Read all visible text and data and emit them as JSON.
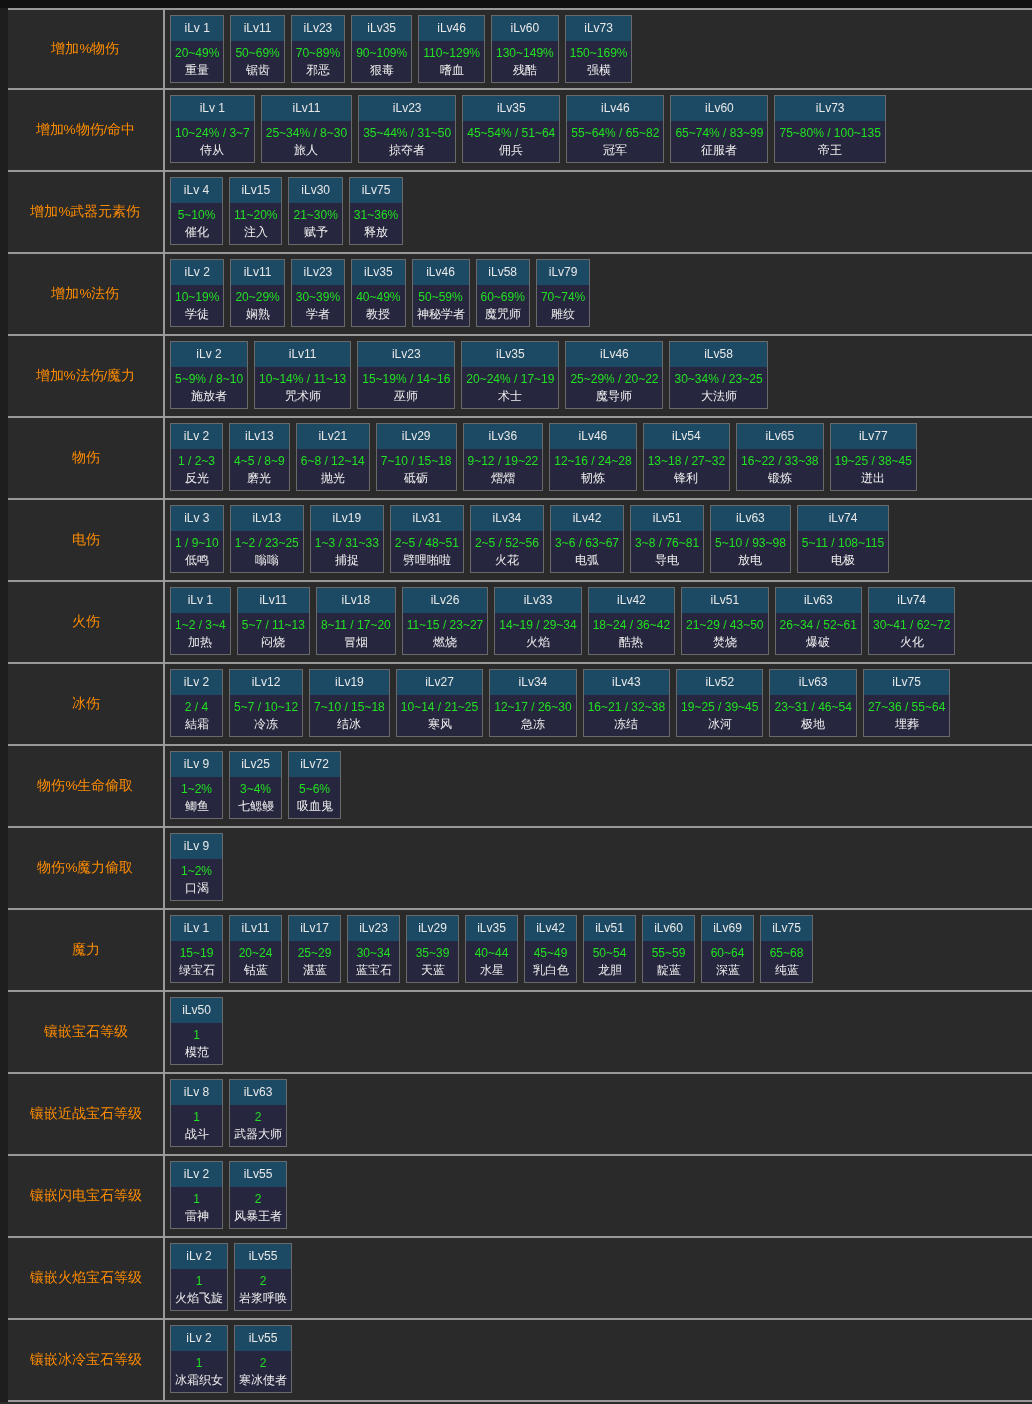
{
  "rows": [
    {
      "label": "增加%物伤",
      "items": [
        {
          "level": "iLv 1",
          "value": "20~49%",
          "name": "重量"
        },
        {
          "level": "iLv11",
          "value": "50~69%",
          "name": "锯齿"
        },
        {
          "level": "iLv23",
          "value": "70~89%",
          "name": "邪恶"
        },
        {
          "level": "iLv35",
          "value": "90~109%",
          "name": "狠毒"
        },
        {
          "level": "iLv46",
          "value": "110~129%",
          "name": "嗜血"
        },
        {
          "level": "iLv60",
          "value": "130~149%",
          "name": "残酷"
        },
        {
          "level": "iLv73",
          "value": "150~169%",
          "name": "强横"
        }
      ]
    },
    {
      "label": "增加%物伤/命中",
      "items": [
        {
          "level": "iLv 1",
          "value": "10~24% / 3~7",
          "name": "侍从"
        },
        {
          "level": "iLv11",
          "value": "25~34% / 8~30",
          "name": "旅人"
        },
        {
          "level": "iLv23",
          "value": "35~44% / 31~50",
          "name": "掠夺者"
        },
        {
          "level": "iLv35",
          "value": "45~54% / 51~64",
          "name": "佣兵"
        },
        {
          "level": "iLv46",
          "value": "55~64% / 65~82",
          "name": "冠军"
        },
        {
          "level": "iLv60",
          "value": "65~74% / 83~99",
          "name": "征服者"
        },
        {
          "level": "iLv73",
          "value": "75~80% / 100~135",
          "name": "帝王"
        }
      ]
    },
    {
      "label": "增加%武器元素伤",
      "items": [
        {
          "level": "iLv 4",
          "value": "5~10%",
          "name": "催化"
        },
        {
          "level": "iLv15",
          "value": "11~20%",
          "name": "注入"
        },
        {
          "level": "iLv30",
          "value": "21~30%",
          "name": "赋予"
        },
        {
          "level": "iLv75",
          "value": "31~36%",
          "name": "释放"
        }
      ]
    },
    {
      "label": "增加%法伤",
      "items": [
        {
          "level": "iLv 2",
          "value": "10~19%",
          "name": "学徒"
        },
        {
          "level": "iLv11",
          "value": "20~29%",
          "name": "娴熟"
        },
        {
          "level": "iLv23",
          "value": "30~39%",
          "name": "学者"
        },
        {
          "level": "iLv35",
          "value": "40~49%",
          "name": "教授"
        },
        {
          "level": "iLv46",
          "value": "50~59%",
          "name": "神秘学者"
        },
        {
          "level": "iLv58",
          "value": "60~69%",
          "name": "魔咒师"
        },
        {
          "level": "iLv79",
          "value": "70~74%",
          "name": "雕纹"
        }
      ]
    },
    {
      "label": "增加%法伤/魔力",
      "items": [
        {
          "level": "iLv 2",
          "value": "5~9% / 8~10",
          "name": "施放者"
        },
        {
          "level": "iLv11",
          "value": "10~14% / 11~13",
          "name": "咒术师"
        },
        {
          "level": "iLv23",
          "value": "15~19% / 14~16",
          "name": "巫师"
        },
        {
          "level": "iLv35",
          "value": "20~24% / 17~19",
          "name": "术士"
        },
        {
          "level": "iLv46",
          "value": "25~29% / 20~22",
          "name": "魔导师"
        },
        {
          "level": "iLv58",
          "value": "30~34% / 23~25",
          "name": "大法师"
        }
      ]
    },
    {
      "label": "物伤",
      "items": [
        {
          "level": "iLv 2",
          "value": "1 / 2~3",
          "name": "反光"
        },
        {
          "level": "iLv13",
          "value": "4~5 / 8~9",
          "name": "磨光"
        },
        {
          "level": "iLv21",
          "value": "6~8 / 12~14",
          "name": "抛光"
        },
        {
          "level": "iLv29",
          "value": "7~10 / 15~18",
          "name": "砥砺"
        },
        {
          "level": "iLv36",
          "value": "9~12 / 19~22",
          "name": "熠熠"
        },
        {
          "level": "iLv46",
          "value": "12~16 / 24~28",
          "name": "韧炼"
        },
        {
          "level": "iLv54",
          "value": "13~18 / 27~32",
          "name": "锋利"
        },
        {
          "level": "iLv65",
          "value": "16~22 / 33~38",
          "name": "锻炼"
        },
        {
          "level": "iLv77",
          "value": "19~25 / 38~45",
          "name": "迸出"
        }
      ]
    },
    {
      "label": "电伤",
      "items": [
        {
          "level": "iLv 3",
          "value": "1 / 9~10",
          "name": "低鸣"
        },
        {
          "level": "iLv13",
          "value": "1~2 / 23~25",
          "name": "嗡嗡"
        },
        {
          "level": "iLv19",
          "value": "1~3 / 31~33",
          "name": "捕捉"
        },
        {
          "level": "iLv31",
          "value": "2~5 / 48~51",
          "name": "劈哩啪啦"
        },
        {
          "level": "iLv34",
          "value": "2~5 / 52~56",
          "name": "火花"
        },
        {
          "level": "iLv42",
          "value": "3~6 / 63~67",
          "name": "电弧"
        },
        {
          "level": "iLv51",
          "value": "3~8 / 76~81",
          "name": "导电"
        },
        {
          "level": "iLv63",
          "value": "5~10 / 93~98",
          "name": "放电"
        },
        {
          "level": "iLv74",
          "value": "5~11 / 108~115",
          "name": "电极"
        }
      ]
    },
    {
      "label": "火伤",
      "items": [
        {
          "level": "iLv 1",
          "value": "1~2 / 3~4",
          "name": "加热"
        },
        {
          "level": "iLv11",
          "value": "5~7 / 11~13",
          "name": "闷烧"
        },
        {
          "level": "iLv18",
          "value": "8~11 / 17~20",
          "name": "冒烟"
        },
        {
          "level": "iLv26",
          "value": "11~15 / 23~27",
          "name": "燃烧"
        },
        {
          "level": "iLv33",
          "value": "14~19 / 29~34",
          "name": "火焰"
        },
        {
          "level": "iLv42",
          "value": "18~24 / 36~42",
          "name": "酷热"
        },
        {
          "level": "iLv51",
          "value": "21~29 / 43~50",
          "name": "焚烧"
        },
        {
          "level": "iLv63",
          "value": "26~34 / 52~61",
          "name": "爆破"
        },
        {
          "level": "iLv74",
          "value": "30~41 / 62~72",
          "name": "火化"
        }
      ]
    },
    {
      "label": "冰伤",
      "items": [
        {
          "level": "iLv 2",
          "value": "2 / 4",
          "name": "結霜"
        },
        {
          "level": "iLv12",
          "value": "5~7 / 10~12",
          "name": "冷冻"
        },
        {
          "level": "iLv19",
          "value": "7~10 / 15~18",
          "name": "结冰"
        },
        {
          "level": "iLv27",
          "value": "10~14 / 21~25",
          "name": "寒风"
        },
        {
          "level": "iLv34",
          "value": "12~17 / 26~30",
          "name": "急冻"
        },
        {
          "level": "iLv43",
          "value": "16~21 / 32~38",
          "name": "冻结"
        },
        {
          "level": "iLv52",
          "value": "19~25 / 39~45",
          "name": "冰河"
        },
        {
          "level": "iLv63",
          "value": "23~31 / 46~54",
          "name": "极地"
        },
        {
          "level": "iLv75",
          "value": "27~36 / 55~64",
          "name": "埋葬"
        }
      ]
    },
    {
      "label": "物伤%生命偷取",
      "items": [
        {
          "level": "iLv 9",
          "value": "1~2%",
          "name": "鲫鱼"
        },
        {
          "level": "iLv25",
          "value": "3~4%",
          "name": "七鳃鳗"
        },
        {
          "level": "iLv72",
          "value": "5~6%",
          "name": "吸血鬼"
        }
      ]
    },
    {
      "label": "物伤%魔力偷取",
      "items": [
        {
          "level": "iLv 9",
          "value": "1~2%",
          "name": "口渴"
        }
      ]
    },
    {
      "label": "魔力",
      "items": [
        {
          "level": "iLv 1",
          "value": "15~19",
          "name": "绿宝石"
        },
        {
          "level": "iLv11",
          "value": "20~24",
          "name": "钴蓝"
        },
        {
          "level": "iLv17",
          "value": "25~29",
          "name": "湛蓝"
        },
        {
          "level": "iLv23",
          "value": "30~34",
          "name": "蓝宝石"
        },
        {
          "level": "iLv29",
          "value": "35~39",
          "name": "天蓝"
        },
        {
          "level": "iLv35",
          "value": "40~44",
          "name": "水星"
        },
        {
          "level": "iLv42",
          "value": "45~49",
          "name": "乳白色"
        },
        {
          "level": "iLv51",
          "value": "50~54",
          "name": "龙胆"
        },
        {
          "level": "iLv60",
          "value": "55~59",
          "name": "靛蓝"
        },
        {
          "level": "iLv69",
          "value": "60~64",
          "name": "深蓝"
        },
        {
          "level": "iLv75",
          "value": "65~68",
          "name": "纯蓝"
        }
      ]
    },
    {
      "label": "镶嵌宝石等级",
      "items": [
        {
          "level": "iLv50",
          "value": "1",
          "name": "模范"
        }
      ]
    },
    {
      "label": "镶嵌近战宝石等级",
      "items": [
        {
          "level": "iLv 8",
          "value": "1",
          "name": "战斗"
        },
        {
          "level": "iLv63",
          "value": "2",
          "name": "武器大师"
        }
      ]
    },
    {
      "label": "镶嵌闪电宝石等级",
      "items": [
        {
          "level": "iLv 2",
          "value": "1",
          "name": "雷神"
        },
        {
          "level": "iLv55",
          "value": "2",
          "name": "风暴王者"
        }
      ]
    },
    {
      "label": "镶嵌火焰宝石等级",
      "items": [
        {
          "level": "iLv 2",
          "value": "1",
          "name": "火焰飞旋"
        },
        {
          "level": "iLv55",
          "value": "2",
          "name": "岩浆呼唤"
        }
      ]
    },
    {
      "label": "镶嵌冰冷宝石等级",
      "items": [
        {
          "level": "iLv 2",
          "value": "1",
          "name": "冰霜织女"
        },
        {
          "level": "iLv55",
          "value": "2",
          "name": "寒冰使者"
        }
      ]
    }
  ]
}
